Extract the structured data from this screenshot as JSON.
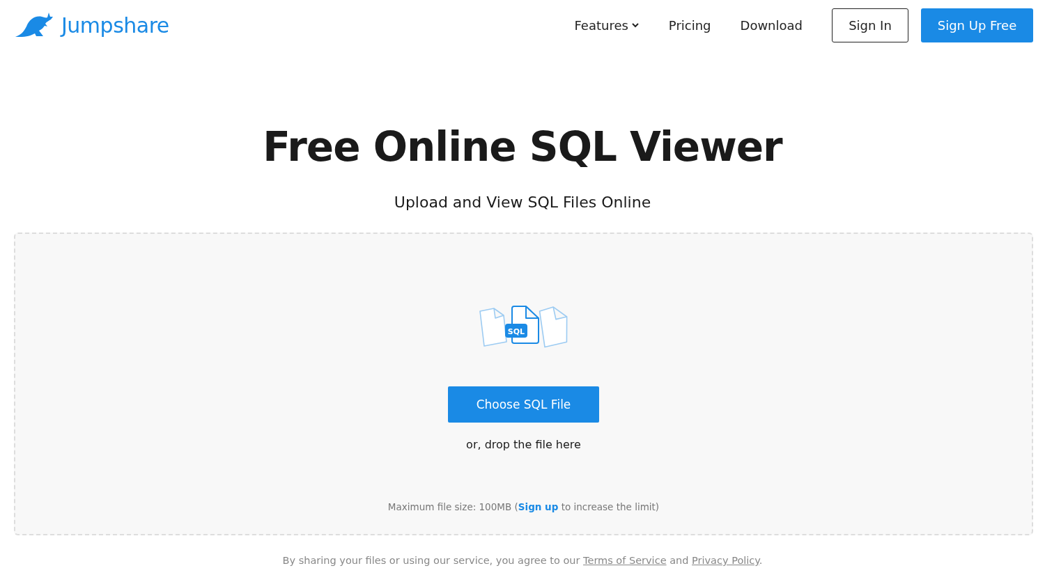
{
  "header": {
    "logo": "Jumpshare",
    "nav": [
      {
        "label": "Features",
        "kind": "dropdown"
      },
      {
        "label": "Pricing",
        "kind": "link"
      },
      {
        "label": "Download",
        "kind": "link"
      }
    ],
    "sign_in": "Sign In",
    "sign_up": "Sign Up Free"
  },
  "hero": {
    "title": "Free Online SQL Viewer",
    "subtitle": "Upload and View SQL Files Online"
  },
  "dropzone": {
    "file_badge": "SQL",
    "button": "Choose SQL File",
    "hint": "or, drop the file here",
    "limit": {
      "before": "Maximum file size: 100MB (",
      "link": "Sign up",
      "after": " to increase the limit)"
    }
  },
  "footer": {
    "before": "By sharing your files or using our service, you agree to our ",
    "link_1": "Terms of Service",
    "middle": " and ",
    "link_2": "Privacy Policy",
    "after": "."
  }
}
